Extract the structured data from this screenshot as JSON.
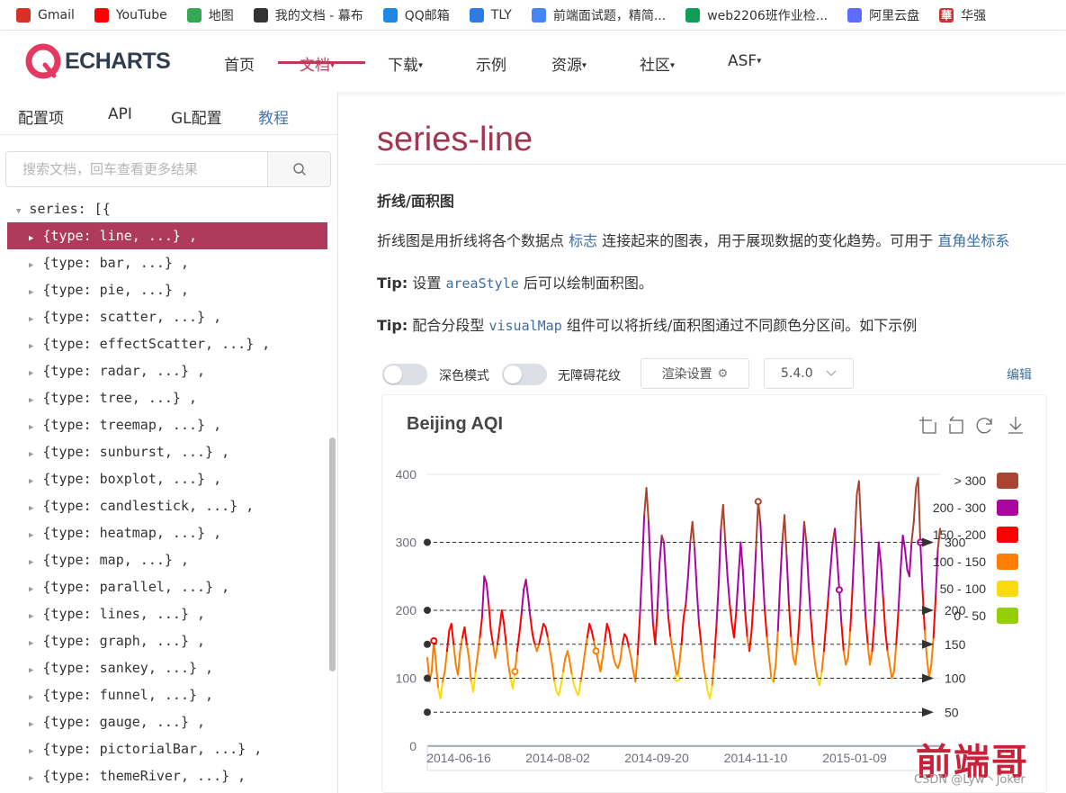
{
  "bookmarks": [
    {
      "label": "Gmail",
      "icon": "gmail-icon",
      "color": "#d93025"
    },
    {
      "label": "YouTube",
      "icon": "youtube-icon",
      "color": "#ff0000"
    },
    {
      "label": "地图",
      "icon": "maps-icon",
      "color": "#34a853"
    },
    {
      "label": "我的文档 - 幕布",
      "icon": "mubu-icon",
      "color": "#333333"
    },
    {
      "label": "QQ邮箱",
      "icon": "qqmail-icon",
      "color": "#1e88e5"
    },
    {
      "label": "TLY",
      "icon": "tly-icon",
      "color": "#2c7be5"
    },
    {
      "label": "前端面试题，精简...",
      "icon": "docs-icon",
      "color": "#4285f4"
    },
    {
      "label": "web2206班作业检...",
      "icon": "sheets-icon",
      "color": "#0f9d58"
    },
    {
      "label": "阿里云盘",
      "icon": "aliyun-drive-icon",
      "color": "#5b6cff"
    },
    {
      "label": "华强",
      "icon": "huaqiang-icon",
      "color": "#d32f2f",
      "glyph": "華"
    }
  ],
  "nav": {
    "logo": "ECHARTS",
    "items": [
      {
        "label": "首页",
        "dropdown": false,
        "active": false
      },
      {
        "label": "文档",
        "dropdown": true,
        "active": true
      },
      {
        "label": "下载",
        "dropdown": true,
        "active": false
      },
      {
        "label": "示例",
        "dropdown": false,
        "active": false
      },
      {
        "label": "资源",
        "dropdown": true,
        "active": false
      },
      {
        "label": "社区",
        "dropdown": true,
        "active": false
      },
      {
        "label": "ASF",
        "dropdown": true,
        "active": false
      }
    ],
    "accent": "#c23657"
  },
  "sidebar": {
    "tabs": [
      "配置项",
      "API",
      "GL配置",
      "教程"
    ],
    "search_placeholder": "搜索文档，回车查看更多结果",
    "tree_root": "series: [{",
    "items": [
      "{type: line, ...} ,",
      "{type: bar, ...} ,",
      "{type: pie, ...} ,",
      "{type: scatter, ...} ,",
      "{type: effectScatter, ...} ,",
      "{type: radar, ...} ,",
      "{type: tree, ...} ,",
      "{type: treemap, ...} ,",
      "{type: sunburst, ...} ,",
      "{type: boxplot, ...} ,",
      "{type: candlestick, ...} ,",
      "{type: heatmap, ...} ,",
      "{type: map, ...} ,",
      "{type: parallel, ...} ,",
      "{type: lines, ...} ,",
      "{type: graph, ...} ,",
      "{type: sankey, ...} ,",
      "{type: funnel, ...} ,",
      "{type: gauge, ...} ,",
      "{type: pictorialBar, ...} ,",
      "{type: themeRiver, ...} ,"
    ],
    "selected_index": 0
  },
  "main": {
    "title": "series-line",
    "subtitle": "折线/面积图",
    "intro": {
      "before": "折线图是用折线将各个数据点",
      "link1": "标志",
      "middle": "连接起来的图表，用于展现数据的变化趋势。可用于",
      "link2": "直角坐标系"
    },
    "tip1": {
      "label": "Tip:",
      "before": "设置",
      "code": "areaStyle",
      "after": "后可以绘制面积图。"
    },
    "tip2": {
      "label": "Tip:",
      "before": "配合分段型",
      "code": "visualMap",
      "after": "组件可以将折线/面积图通过不同颜色分区间。如下示例"
    },
    "toolbar": {
      "dark_mode_label": "深色模式",
      "dark_mode_on": false,
      "a11y_label": "无障碍花纹",
      "a11y_on": false,
      "render_label": "渲染设置",
      "version": "5.4.0",
      "edit_label": "编辑"
    }
  },
  "watermark": {
    "text": "前端哥",
    "csdn": "CSDN @Lyw丶Joker"
  },
  "chart_data": {
    "type": "line",
    "title": "Beijing AQI",
    "ylim": [
      0,
      400
    ],
    "y_ticks": [
      0,
      100,
      200,
      300,
      400
    ],
    "x_ticks": [
      "2014-06-16",
      "2014-08-02",
      "2014-09-20",
      "2014-11-10",
      "2015-01-09"
    ],
    "markLines": [
      50,
      100,
      150,
      200,
      300
    ],
    "pieces": [
      {
        "label": "> 300",
        "color": "#aa4431"
      },
      {
        "label": "200 - 300",
        "color": "#aa069f"
      },
      {
        "label": "150 - 200",
        "color": "#ff0000"
      },
      {
        "label": "100 - 150",
        "color": "#fd7e00"
      },
      {
        "label": "50 - 100",
        "color": "#fbdb0f"
      },
      {
        "label": "0 - 50",
        "color": "#93ce07"
      }
    ],
    "series": [
      {
        "name": "Beijing AQI",
        "values": [
          130,
          95,
          110,
          155,
          120,
          85,
          70,
          95,
          110,
          140,
          170,
          180,
          150,
          120,
          105,
          140,
          160,
          175,
          150,
          130,
          95,
          80,
          110,
          135,
          160,
          190,
          250,
          240,
          210,
          170,
          150,
          130,
          150,
          175,
          200,
          180,
          150,
          120,
          100,
          85,
          110,
          140,
          165,
          195,
          230,
          245,
          220,
          190,
          165,
          150,
          140,
          150,
          165,
          180,
          175,
          160,
          140,
          120,
          95,
          80,
          75,
          90,
          110,
          130,
          140,
          125,
          105,
          90,
          80,
          75,
          95,
          115,
          140,
          160,
          180,
          170,
          155,
          140,
          125,
          110,
          130,
          155,
          180,
          170,
          150,
          130,
          120,
          115,
          125,
          150,
          165,
          160,
          145,
          130,
          110,
          95,
          135,
          190,
          260,
          340,
          380,
          330,
          250,
          180,
          150,
          200,
          270,
          310,
          300,
          240,
          190,
          160,
          140,
          120,
          100,
          120,
          150,
          190,
          210,
          250,
          300,
          330,
          290,
          230,
          180,
          150,
          120,
          100,
          80,
          70,
          90,
          130,
          180,
          240,
          320,
          355,
          300,
          250,
          210,
          180,
          160,
          200,
          250,
          300,
          260,
          200,
          160,
          140,
          170,
          220,
          290,
          360,
          330,
          260,
          200,
          160,
          130,
          100,
          95,
          120,
          170,
          240,
          300,
          340,
          280,
          210,
          160,
          130,
          120,
          150,
          200,
          270,
          330,
          300,
          240,
          190,
          150,
          120,
          100,
          90,
          110,
          140,
          180,
          220,
          260,
          300,
          320,
          280,
          230,
          180,
          140,
          120,
          130,
          170,
          230,
          300,
          370,
          390,
          320,
          250,
          190,
          150,
          120,
          140,
          180,
          240,
          300,
          270,
          220,
          170,
          140,
          120,
          100,
          110,
          150,
          200,
          260,
          310,
          290,
          260,
          250,
          300,
          330,
          380,
          395,
          300,
          230,
          170,
          130,
          100,
          120,
          160,
          220,
          290,
          320
        ]
      }
    ]
  }
}
